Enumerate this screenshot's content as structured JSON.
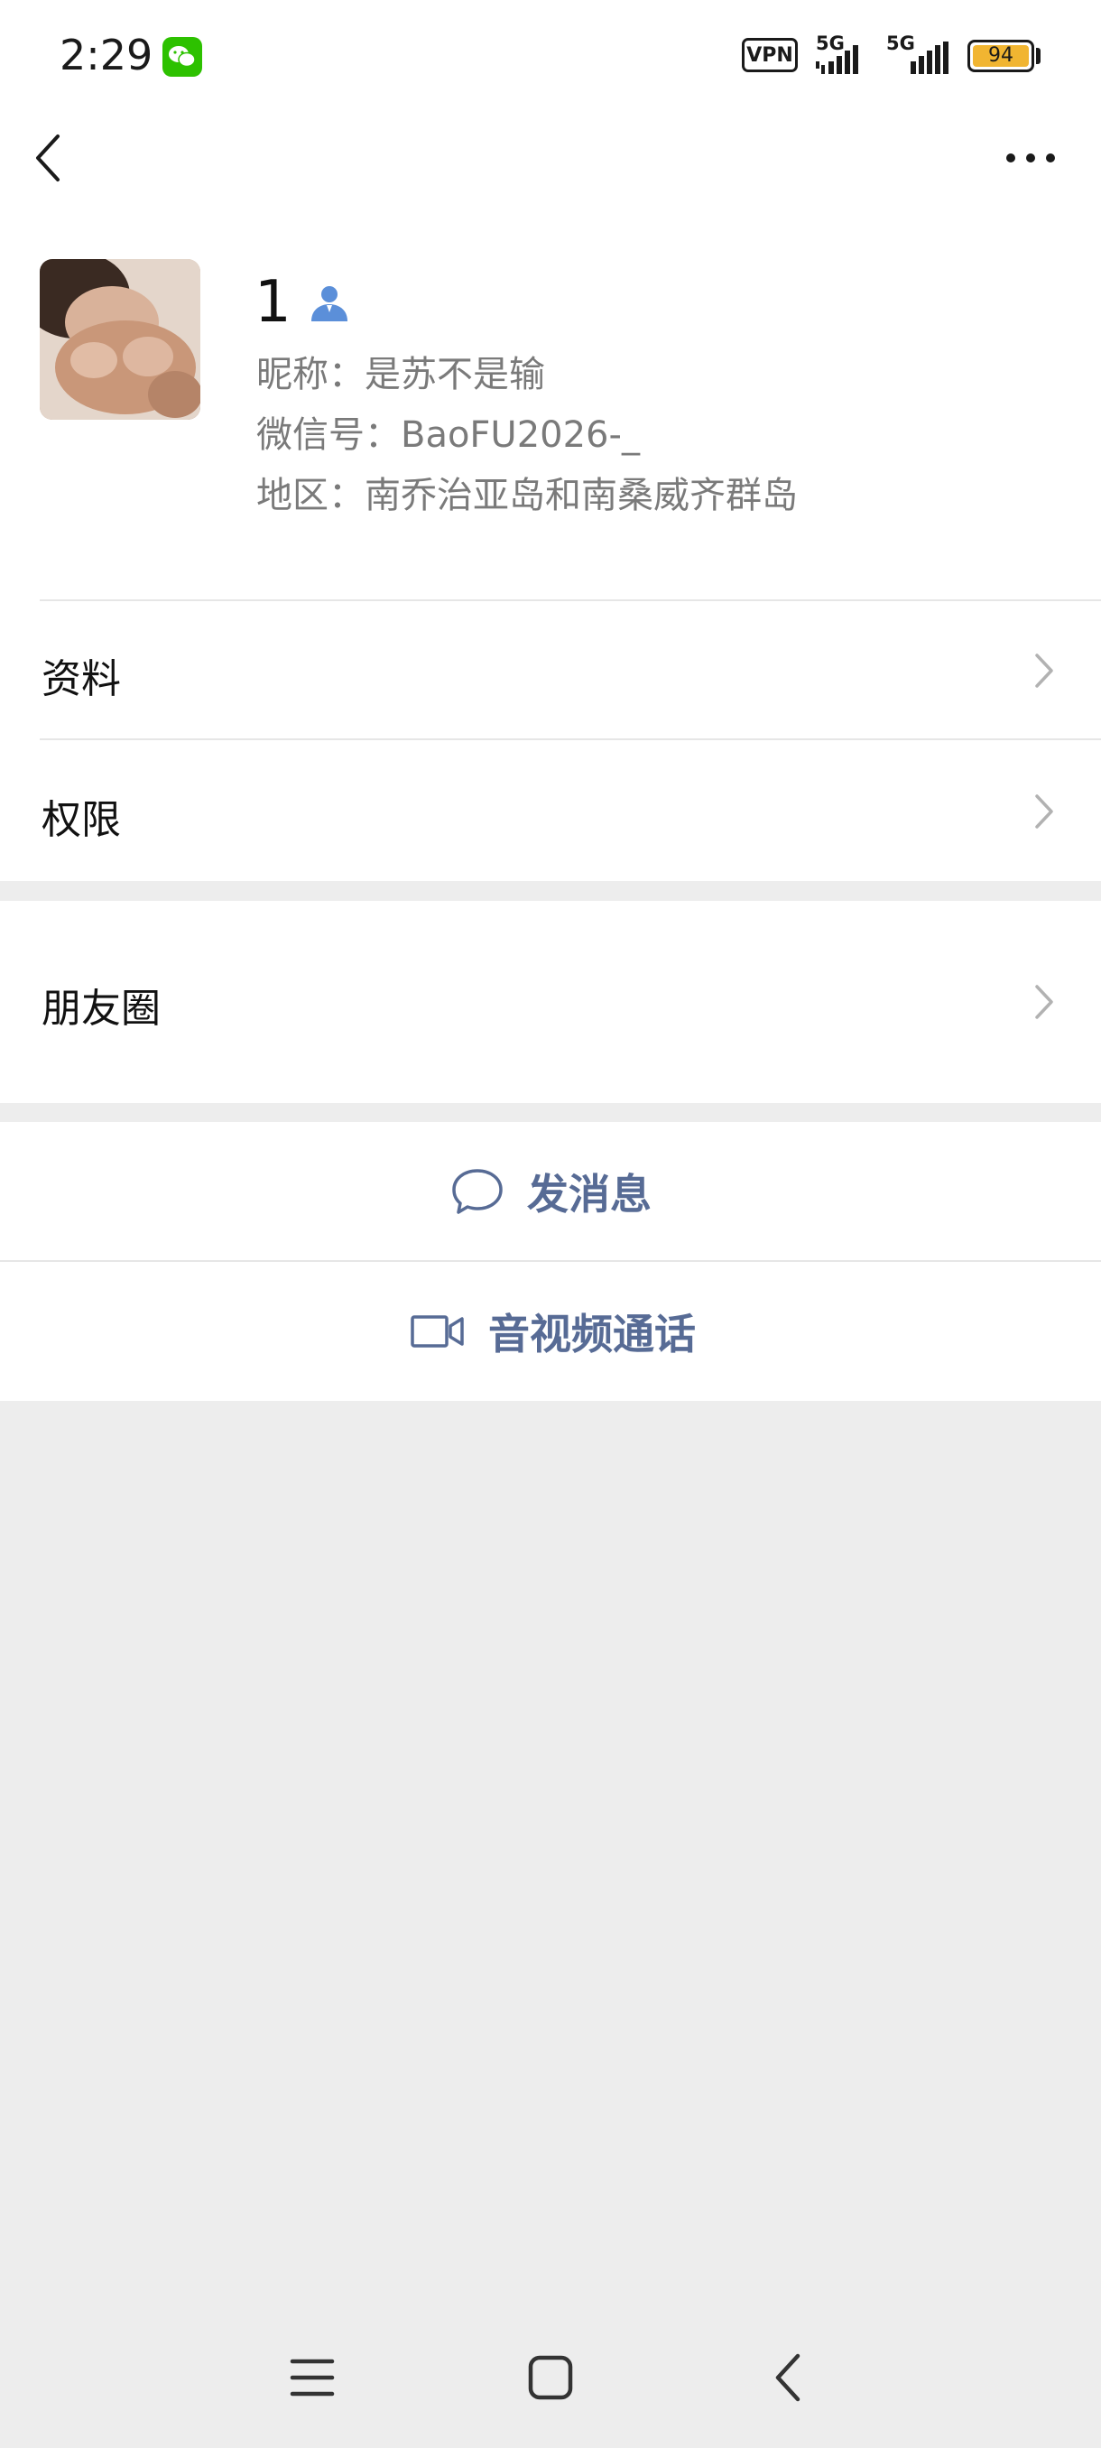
{
  "status_bar": {
    "time": "2:29",
    "vpn_label": "VPN",
    "net1_label": "5G",
    "net2_label": "5G",
    "battery_level": "94",
    "notification_icon": "wechat-icon"
  },
  "nav": {
    "back_icon": "back-chevron-icon",
    "more_icon": "more-dots-icon"
  },
  "profile": {
    "name": "1",
    "nickname": "昵称：是苏不是输",
    "wechat_id": "微信号：BaoFU2026-_",
    "region": "地区：南乔治亚岛和南桑威齐群岛"
  },
  "cells": {
    "info_label": "资料",
    "permissions_label": "权限",
    "moments_label": "朋友圈"
  },
  "actions": {
    "message_label": "发消息",
    "call_label": "音视频通话"
  },
  "colors": {
    "link_blue": "#576b95",
    "background": "#ededed",
    "wechat_green": "#2dc100",
    "battery_yellow": "#f1b531"
  }
}
